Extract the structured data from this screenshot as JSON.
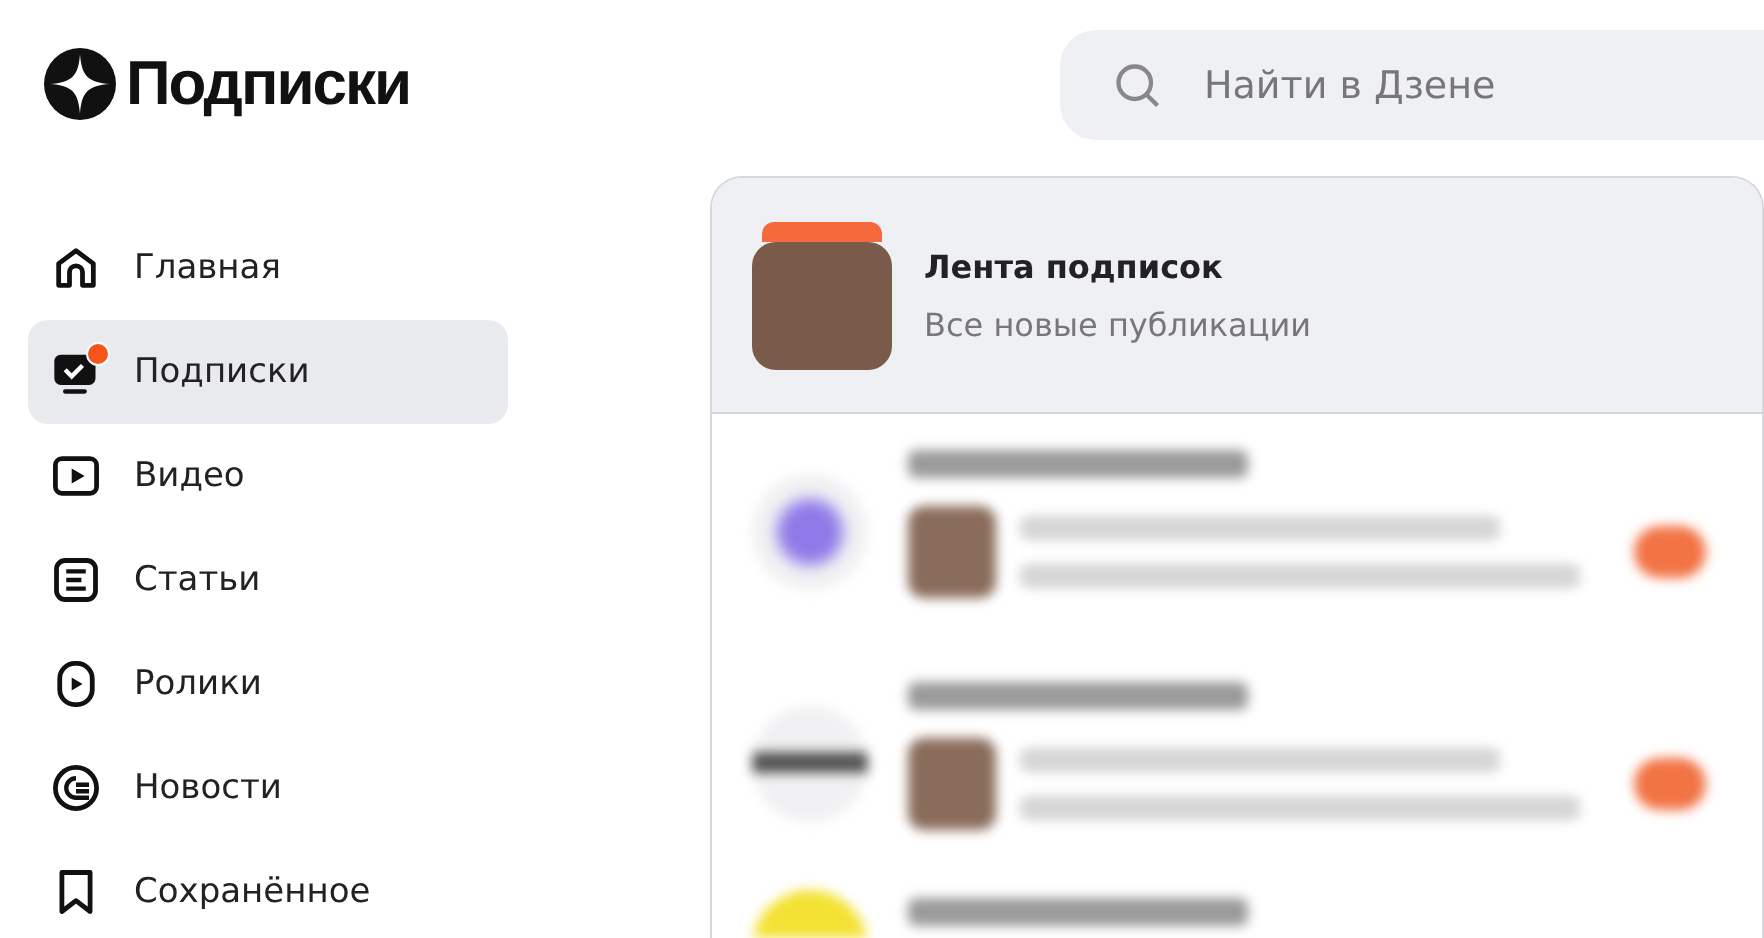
{
  "header": {
    "title": "Подписки"
  },
  "search": {
    "placeholder": "Найти в Дзене"
  },
  "sidebar": {
    "items": [
      {
        "kind": "home",
        "label": "Главная",
        "selected": false,
        "notification_dot": false
      },
      {
        "kind": "subscriptions",
        "label": "Подписки",
        "selected": true,
        "notification_dot": true
      },
      {
        "kind": "video",
        "label": "Видео",
        "selected": false,
        "notification_dot": false
      },
      {
        "kind": "articles",
        "label": "Статьи",
        "selected": false,
        "notification_dot": false
      },
      {
        "kind": "clips",
        "label": "Ролики",
        "selected": false,
        "notification_dot": false
      },
      {
        "kind": "news",
        "label": "Новости",
        "selected": false,
        "notification_dot": false
      },
      {
        "kind": "saved",
        "label": "Сохранённое",
        "selected": false,
        "notification_dot": false
      }
    ]
  },
  "feed": {
    "title": "Лента подписок",
    "subtitle": "Все новые публикации"
  }
}
